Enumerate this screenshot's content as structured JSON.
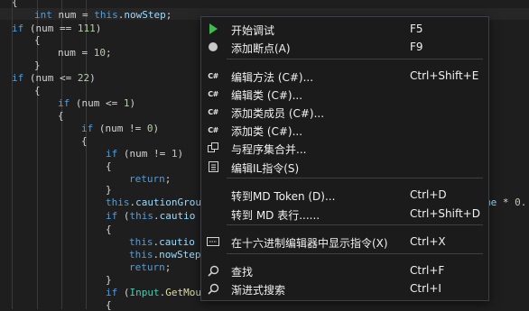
{
  "editor": {
    "lines": [
      [
        [
          "plain",
          "{"
        ]
      ],
      [
        [
          "kw",
          "int"
        ],
        [
          "plain",
          " num = "
        ],
        [
          "kw",
          "this"
        ],
        [
          "plain",
          "."
        ],
        [
          "fld",
          "nowStep"
        ],
        [
          "plain",
          ";"
        ]
      ],
      [
        [
          "kw",
          "if"
        ],
        [
          "plain",
          " (num == "
        ],
        [
          "num",
          "111"
        ],
        [
          "plain",
          ")"
        ]
      ],
      [
        [
          "plain",
          "{"
        ]
      ],
      [
        [
          "plain",
          "num = "
        ],
        [
          "num",
          "10"
        ],
        [
          "plain",
          ";"
        ]
      ],
      [
        [
          "plain",
          "}"
        ]
      ],
      [
        [
          "kw",
          "if"
        ],
        [
          "plain",
          " (num <= "
        ],
        [
          "num",
          "22"
        ],
        [
          "plain",
          ")"
        ]
      ],
      [
        [
          "plain",
          "{"
        ]
      ],
      [
        [
          "kw",
          "if"
        ],
        [
          "plain",
          " (num <= "
        ],
        [
          "num",
          "1"
        ],
        [
          "plain",
          ")"
        ]
      ],
      [
        [
          "plain",
          "{"
        ]
      ],
      [
        [
          "kw",
          "if"
        ],
        [
          "plain",
          " (num != "
        ],
        [
          "num",
          "0"
        ],
        [
          "plain",
          ")"
        ]
      ],
      [
        [
          "plain",
          "{"
        ]
      ],
      [
        [
          "kw",
          "if"
        ],
        [
          "plain",
          " (num != "
        ],
        [
          "num",
          "1"
        ],
        [
          "plain",
          ")"
        ]
      ],
      [
        [
          "plain",
          "{"
        ]
      ],
      [
        [
          "kw",
          "return"
        ],
        [
          "plain",
          ";"
        ]
      ],
      [
        [
          "plain",
          "}"
        ]
      ],
      [
        [
          "kw",
          "this"
        ],
        [
          "plain",
          "."
        ],
        [
          "fld",
          "cautionGrou"
        ]
      ],
      [
        [
          "kw",
          "if"
        ],
        [
          "plain",
          " ("
        ],
        [
          "kw",
          "this"
        ],
        [
          "plain",
          "."
        ],
        [
          "fld",
          "cautio"
        ]
      ],
      [
        [
          "plain",
          "{"
        ]
      ],
      [
        [
          "kw",
          "this"
        ],
        [
          "plain",
          "."
        ],
        [
          "fld",
          "cautio"
        ]
      ],
      [
        [
          "kw",
          "this"
        ],
        [
          "plain",
          "."
        ],
        [
          "fld",
          "nowStep"
        ]
      ],
      [
        [
          "kw",
          "return"
        ],
        [
          "plain",
          ";"
        ]
      ],
      [
        [
          "plain",
          "}"
        ]
      ],
      [
        [
          "kw",
          "if"
        ],
        [
          "plain",
          " ("
        ],
        [
          "cls",
          "Input"
        ],
        [
          "plain",
          "."
        ],
        [
          "meth",
          "GetMou"
        ]
      ],
      [
        [
          "plain",
          "{"
        ]
      ]
    ],
    "tail": [
      [
        "fld",
        "me"
      ],
      [
        "plain",
        " * "
      ],
      [
        "num",
        "0."
      ]
    ]
  },
  "menu": {
    "items": [
      {
        "icon": "play-icon",
        "label": "开始调试",
        "shortcut": "F5"
      },
      {
        "icon": "breakpoint-icon",
        "label": "添加断点(A)",
        "shortcut": "F9"
      },
      {
        "sep": true
      },
      {
        "icon": "csharp-icon",
        "icon_text": "C#",
        "label": "编辑方法 (C#)...",
        "shortcut": "Ctrl+Shift+E"
      },
      {
        "icon": "csharp-icon",
        "icon_text": "C#",
        "label": "编辑类 (C#)...",
        "shortcut": ""
      },
      {
        "icon": "csharp-icon",
        "icon_text": "C#",
        "label": "添加类成员 (C#)...",
        "shortcut": ""
      },
      {
        "icon": "csharp-icon",
        "icon_text": "C#",
        "label": "添加类 (C#)...",
        "shortcut": ""
      },
      {
        "icon": "merge-icon",
        "label": "与程序集合并...",
        "shortcut": ""
      },
      {
        "icon": "il-instructions-icon",
        "label": "编辑IL指令(S)",
        "shortcut": ""
      },
      {
        "sep": true
      },
      {
        "icon": "",
        "label": "转到MD Token (D)...",
        "shortcut": "Ctrl+D"
      },
      {
        "icon": "",
        "label": "转到 MD 表行......",
        "shortcut": "Ctrl+Shift+D"
      },
      {
        "sep": true
      },
      {
        "icon": "hex-editor-icon",
        "label": "在十六进制编辑器中显示指令(X)",
        "shortcut": "Ctrl+X"
      },
      {
        "sep": true
      },
      {
        "icon": "search-icon",
        "label": "查找",
        "shortcut": "Ctrl+F"
      },
      {
        "icon": "search-icon",
        "label": "渐进式搜索",
        "shortcut": "Ctrl+I"
      }
    ]
  }
}
